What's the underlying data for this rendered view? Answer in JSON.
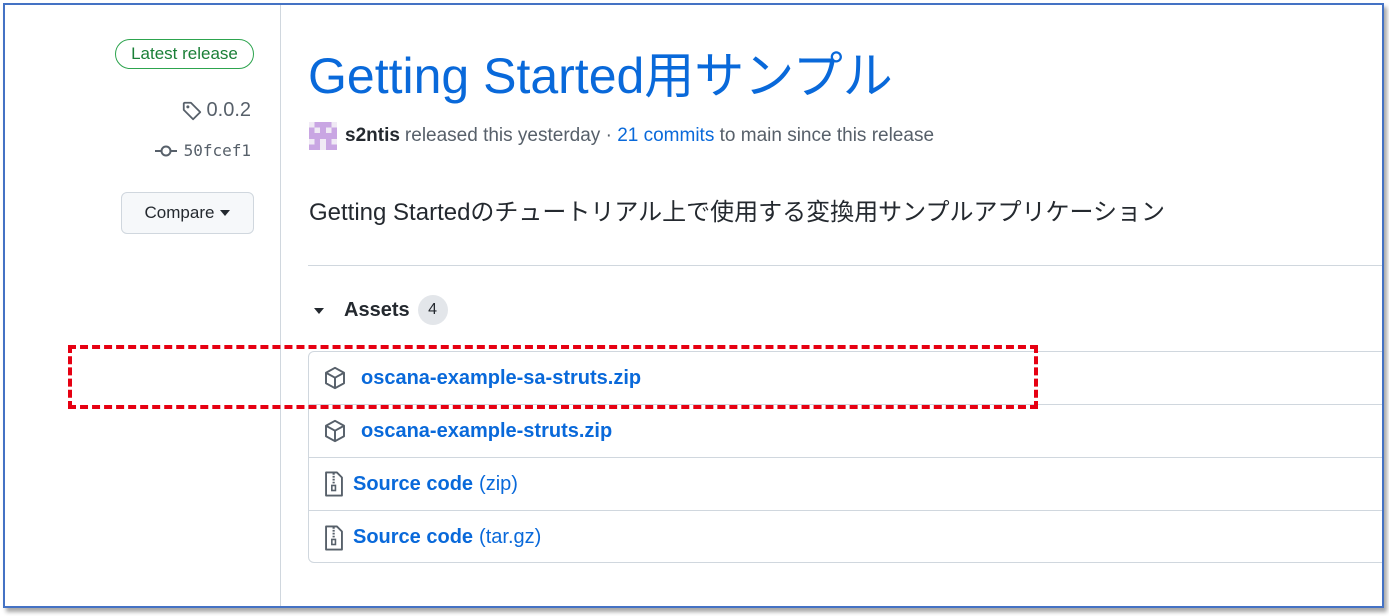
{
  "sidebar": {
    "latest_badge": "Latest release",
    "tag": "0.0.2",
    "commit": "50fcef1",
    "compare_label": "Compare"
  },
  "release": {
    "title": "Getting Started用サンプル",
    "author": "s2ntis",
    "released_text": "released this yesterday ·",
    "commits_link": "21 commits",
    "commits_suffix": "to main since this release",
    "description": "Getting Startedのチュートリアル上で使用する変換用サンプルアプリケーション"
  },
  "assets": {
    "title": "Assets",
    "count": "4",
    "items": [
      {
        "name": "oscana-example-sa-struts.zip",
        "icon": "package-icon"
      },
      {
        "name": "oscana-example-struts.zip",
        "icon": "package-icon"
      },
      {
        "name": "Source code",
        "suffix": "(zip)",
        "icon": "file-zip-icon"
      },
      {
        "name": "Source code",
        "suffix": "(tar.gz)",
        "icon": "file-zip-icon"
      }
    ]
  },
  "colors": {
    "link": "#0969da",
    "badge_green": "#1a7f37",
    "highlight_red": "#e60012",
    "frame_blue": "#4472c4"
  }
}
